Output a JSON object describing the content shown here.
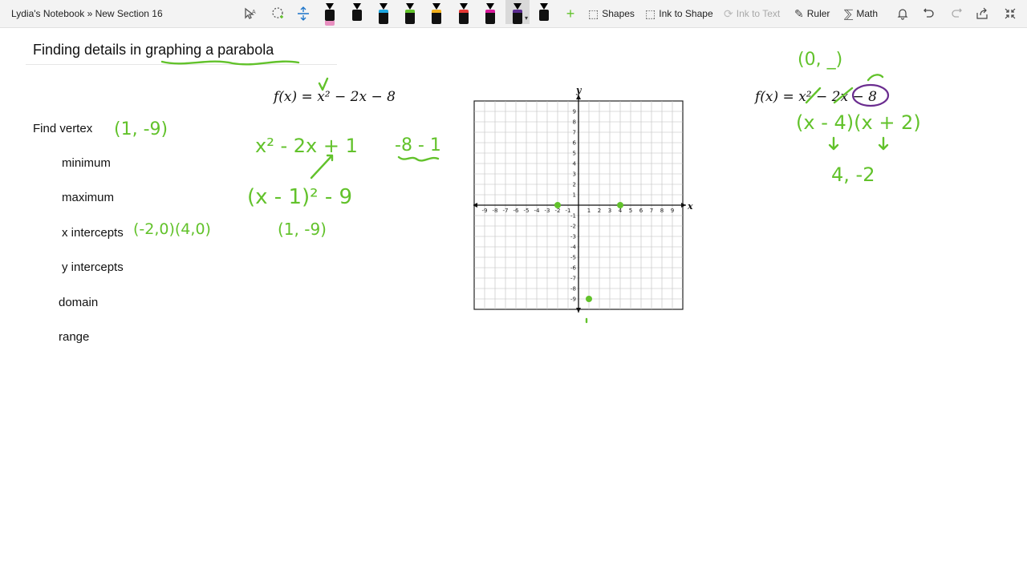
{
  "app": {
    "breadcrumb": "Lydia's Notebook » New Section 16"
  },
  "toolbar": {
    "shapes_label": "Shapes",
    "ink_to_shape_label": "Ink to Shape",
    "ink_to_text_label": "Ink to Text",
    "ruler_label": "Ruler",
    "math_label": "Math",
    "pen_colors": [
      "#000000",
      "#000000",
      "#1ea7e1",
      "#62c22b",
      "#f2b01e",
      "#e53935",
      "#d81b9b",
      "#5c2d91",
      "#000000"
    ],
    "accent": "#62c22b"
  },
  "page": {
    "title": "Finding details in graphing a parabola",
    "prompts": {
      "find_vertex": "Find vertex",
      "minimum": "minimum",
      "maximum": "maximum",
      "x_intercepts": "x intercepts",
      "y_intercepts": "y intercepts",
      "domain": "domain",
      "range": "range"
    },
    "equation_left": "f(x) = x² − 2x − 8",
    "equation_right": "f(x) = x² − 2x − 8"
  },
  "ink": {
    "vertex_answer": "(1, -9)",
    "x_intercepts_answer": "(-2,0)(4,0)",
    "completing_square_1": "x² - 2x + 1",
    "completing_square_2": "-8 - 1",
    "completing_square_3": "(x - 1)² - 9",
    "vertex_written": "(1, -9)",
    "y_intercept_partial": "(0, _)",
    "factored": "(x - 4)(x + 2)",
    "roots": "4, -2",
    "ink_green": "#62c22b",
    "ink_purple": "#6a2c8f"
  },
  "graph": {
    "x_axis_label": "x",
    "y_axis_label": "y",
    "x_ticks": [
      "-9",
      "-8",
      "-7",
      "-6",
      "-5",
      "-4",
      "-3",
      "-2",
      "-1",
      "1",
      "2",
      "3",
      "4",
      "5",
      "6",
      "7",
      "8",
      "9"
    ],
    "y_ticks": [
      "9",
      "8",
      "7",
      "6",
      "5",
      "4",
      "3",
      "2",
      "1",
      "-1",
      "-2",
      "-3",
      "-4",
      "-5",
      "-6",
      "-7",
      "-8",
      "-9"
    ],
    "range": [
      -9,
      9
    ],
    "points": [
      {
        "x": -2,
        "y": 0
      },
      {
        "x": 4,
        "y": 0
      },
      {
        "x": 1,
        "y": -9
      }
    ]
  }
}
